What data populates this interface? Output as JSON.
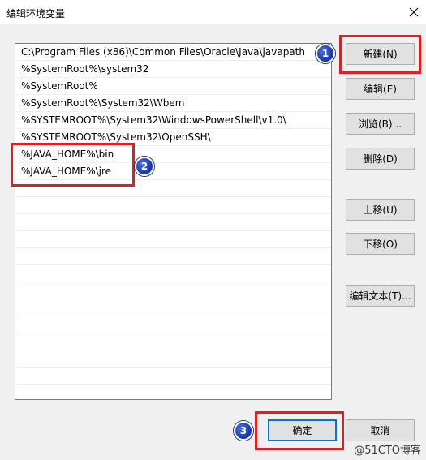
{
  "window": {
    "title": "编辑环境变量"
  },
  "paths": [
    "C:\\Program Files (x86)\\Common Files\\Oracle\\Java\\javapath",
    "%SystemRoot%\\system32",
    "%SystemRoot%",
    "%SystemRoot%\\System32\\Wbem",
    "%SYSTEMROOT%\\System32\\WindowsPowerShell\\v1.0\\",
    "%SYSTEMROOT%\\System32\\OpenSSH\\",
    "%JAVA_HOME%\\bin",
    "%JAVA_HOME%\\jre"
  ],
  "buttons": {
    "new": "新建(N)",
    "edit": "编辑(E)",
    "browse": "浏览(B)...",
    "delete": "删除(D)",
    "move_up": "上移(U)",
    "move_down": "下移(O)",
    "edit_text": "编辑文本(T)...",
    "ok": "确定",
    "cancel": "取消"
  },
  "annotations": {
    "badge1": "1",
    "badge2": "2",
    "badge3": "3"
  },
  "watermark": "@51CTO博客",
  "colors": {
    "highlight_box": "#e02020",
    "badge": "#1c3cb5",
    "focus_border": "#0078d7"
  },
  "icons": {
    "close": "close-icon"
  }
}
